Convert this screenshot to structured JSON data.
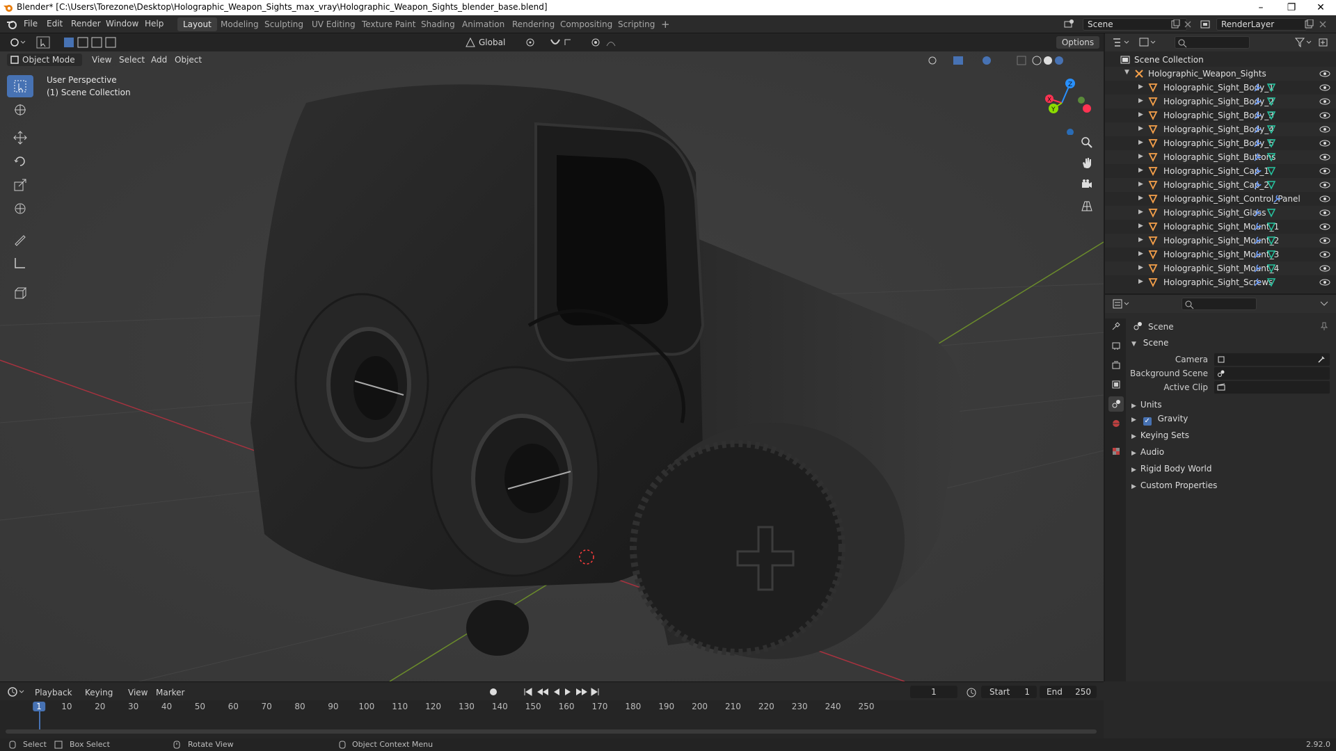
{
  "window": {
    "title": "Blender* [C:\\Users\\Torezone\\Desktop\\Holographic_Weapon_Sights_max_vray\\Holographic_Weapon_Sights_blender_base.blend]"
  },
  "menu": [
    "File",
    "Edit",
    "Render",
    "Window",
    "Help"
  ],
  "workspaces": [
    {
      "label": "Layout",
      "active": true
    },
    {
      "label": "Modeling"
    },
    {
      "label": "Sculpting"
    },
    {
      "label": "UV Editing"
    },
    {
      "label": "Texture Paint"
    },
    {
      "label": "Shading"
    },
    {
      "label": "Animation"
    },
    {
      "label": "Rendering"
    },
    {
      "label": "Compositing"
    },
    {
      "label": "Scripting"
    }
  ],
  "add_workspace": "+",
  "scene_field": "Scene",
  "renderlayer_field": "RenderLayer",
  "viewport": {
    "mode": "Object Mode",
    "menus": [
      "View",
      "Select",
      "Add",
      "Object"
    ],
    "orientation": "Global",
    "options": "Options",
    "overlay_text_1": "User Perspective",
    "overlay_text_2": "(1) Scene Collection",
    "axes": {
      "x": "X",
      "y": "Y",
      "z": "Z"
    }
  },
  "outliner": {
    "root": "Scene Collection",
    "collection": "Holographic_Weapon_Sights",
    "items": [
      "Holographic_Sight_Body_1",
      "Holographic_Sight_Body_2",
      "Holographic_Sight_Body_3",
      "Holographic_Sight_Body_4",
      "Holographic_Sight_Body_5",
      "Holographic_Sight_Buttons",
      "Holographic_Sight_Cap_1",
      "Holographic_Sight_Cap_2",
      "Holographic_Sight_Control_Panel",
      "Holographic_Sight_Glass",
      "Holographic_Sight_Mount_1",
      "Holographic_Sight_Mount_2",
      "Holographic_Sight_Mount_3",
      "Holographic_Sight_Mount_4",
      "Holographic_Sight_Screws"
    ]
  },
  "properties": {
    "context": "Scene",
    "panel": "Scene",
    "camera_label": "Camera",
    "background_scene_label": "Background Scene",
    "active_clip_label": "Active Clip",
    "subpanels": [
      "Units",
      "Gravity",
      "Keying Sets",
      "Audio",
      "Rigid Body World",
      "Custom Properties"
    ],
    "gravity_checked": true
  },
  "timeline": {
    "menus": [
      "Playback",
      "Keying",
      "View",
      "Marker"
    ],
    "current_frame": "1",
    "start_label": "Start",
    "start_value": "1",
    "end_label": "End",
    "end_value": "250",
    "ticks": [
      "1",
      "10",
      "20",
      "30",
      "40",
      "50",
      "60",
      "70",
      "80",
      "90",
      "100",
      "110",
      "120",
      "130",
      "140",
      "150",
      "160",
      "170",
      "180",
      "190",
      "200",
      "210",
      "220",
      "230",
      "240",
      "250"
    ]
  },
  "statusbar": {
    "select": "Select",
    "box_select": "Box Select",
    "rotate_view": "Rotate View",
    "context_menu": "Object Context Menu",
    "version": "2.92.0"
  },
  "colors": {
    "accent": "#4772b3",
    "x_axis": "#ff3352",
    "y_axis": "#8bdc00",
    "z_axis": "#2890ff",
    "object_icon": "#f5a04a",
    "mesh_icon": "#26c4a0"
  }
}
